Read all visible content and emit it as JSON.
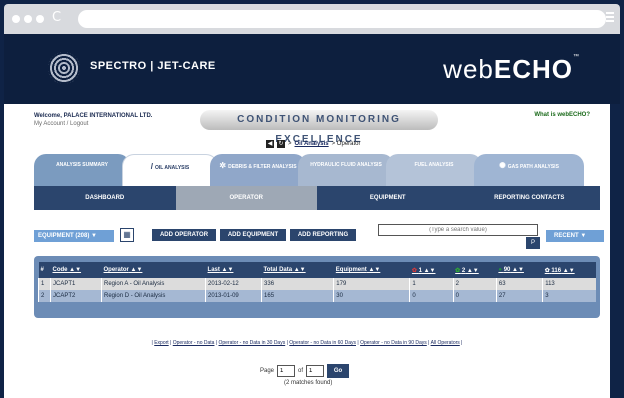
{
  "browser": {
    "reload_glyph": "C"
  },
  "header": {
    "brand_text": "SPECTRO | JET-CARE",
    "product_prefix": "web",
    "product_suffix": "ECHO",
    "tm": "™"
  },
  "topbar": {
    "welcome": "Welcome, PALACE INTERNATIONAL LTD.",
    "account_links": "My Account / Logout",
    "tagline": "CONDITION MONITORING EXCELLENCE",
    "what_is": "What is webECHO?"
  },
  "breadcrumb": {
    "link": "Oil Analysis",
    "sep": ">",
    "current": "> Operator"
  },
  "tabs": [
    {
      "label": "ANALYSIS SUMMARY"
    },
    {
      "label": "OIL ANALYSIS"
    },
    {
      "label": "DEBRIS & FILTER ANALYSIS"
    },
    {
      "label": "HYDRAULIC FLUID ANALYSIS"
    },
    {
      "label": "FUEL ANALYSIS"
    },
    {
      "label": "GAS PATH ANALYSIS"
    }
  ],
  "subnav": [
    "DASHBOARD",
    "OPERATOR",
    "EQUIPMENT",
    "REPORTING CONTACTS"
  ],
  "toolbar": {
    "equipment_select": "EQUIPMENT (208) ▼",
    "add_operator": "ADD OPERATOR",
    "add_equipment": "ADD EQUIPMENT",
    "add_reporting": "ADD REPORTING",
    "search_placeholder": "(Type a search value)",
    "search_glyph": "P",
    "recent": "RECENT ▼"
  },
  "table": {
    "headers": [
      "#",
      "Code",
      "Operator",
      "Last",
      "Total Data",
      "Equipment",
      "1",
      "2",
      "90",
      "116"
    ],
    "rows": [
      [
        "1",
        "JCAPT1",
        "Region A - Oil Analysis",
        "2013-02-12",
        "336",
        "179",
        "1",
        "2",
        "63",
        "113"
      ],
      [
        "2",
        "JCAPT2",
        "Region D - Oil Analysis",
        "2013-01-09",
        "165",
        "30",
        "0",
        "0",
        "27",
        "3"
      ]
    ]
  },
  "footer": {
    "links": [
      "Export",
      "Operator - no Data",
      "Operator - no Data in 30 Days",
      "Operator - no Data in 60 Days",
      "Operator - no Data in 90 Days",
      "All Operators"
    ]
  },
  "pager": {
    "page_label": "Page",
    "page_value": "1",
    "of_label": "of",
    "of_value": "1",
    "go": "Go",
    "matches": "(2 matches found)"
  }
}
